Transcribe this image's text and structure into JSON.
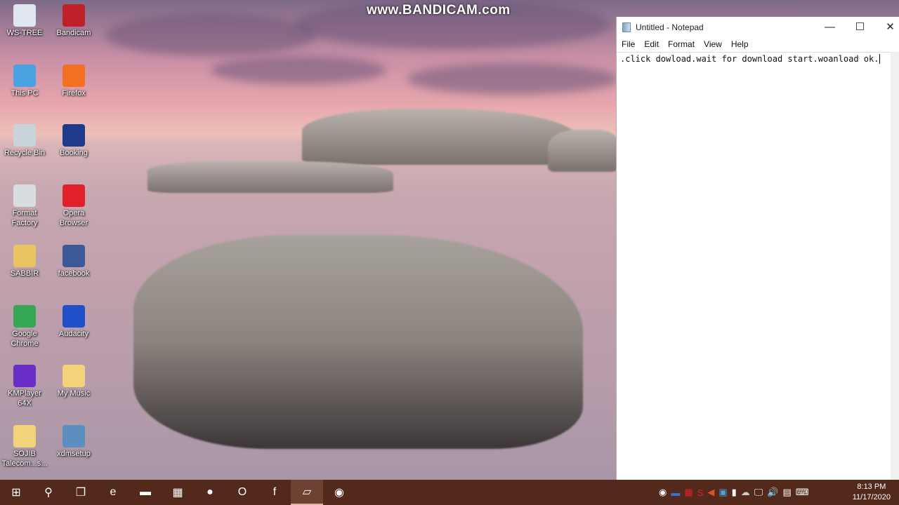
{
  "watermark": "www.BANDICAM.com",
  "desktop_icons": [
    {
      "label": "WS-TREE",
      "icon": "settings-shortcut-icon",
      "color": "#dfe6ee"
    },
    {
      "label": "Bandicam",
      "icon": "bandicam-icon",
      "color": "#c0202a"
    },
    {
      "label": "This PC",
      "icon": "computer-icon",
      "color": "#4aa3e0"
    },
    {
      "label": "Firefox",
      "icon": "firefox-icon",
      "color": "#f36f21"
    },
    {
      "label": "Recycle Bin",
      "icon": "recycle-bin-icon",
      "color": "#c9d3da"
    },
    {
      "label": "Booking",
      "icon": "booking-icon",
      "color": "#1e3a8a"
    },
    {
      "label": "Format Factory",
      "icon": "format-factory-icon",
      "color": "#d8dde2"
    },
    {
      "label": "Opera Browser",
      "icon": "opera-icon",
      "color": "#e0202a"
    },
    {
      "label": "SABBIR",
      "icon": "user-folder-icon",
      "color": "#e8c560"
    },
    {
      "label": "facebook",
      "icon": "facebook-icon",
      "color": "#3b5998"
    },
    {
      "label": "Google Chrome",
      "icon": "chrome-icon",
      "color": "#34a853"
    },
    {
      "label": "Audacity",
      "icon": "audacity-icon",
      "color": "#1f4fc9"
    },
    {
      "label": "KMPlayer 64X",
      "icon": "kmplayer-icon",
      "color": "#6a2fc9"
    },
    {
      "label": "My Music",
      "icon": "folder-icon",
      "color": "#f2d37a"
    },
    {
      "label": "SOJIB Talecom...s...",
      "icon": "folder-icon",
      "color": "#f2d37a"
    },
    {
      "label": "xdmsetup",
      "icon": "installer-icon",
      "color": "#5b8fbf"
    }
  ],
  "notepad": {
    "title": "Untitled - Notepad",
    "menu": [
      "File",
      "Edit",
      "Format",
      "View",
      "Help"
    ],
    "text": ".click dowload.wait for download start.woanload ok."
  },
  "taskbar": {
    "apps": [
      {
        "name": "start",
        "glyph": "⊞"
      },
      {
        "name": "search",
        "glyph": "⚲"
      },
      {
        "name": "task-view",
        "glyph": "❐"
      },
      {
        "name": "edge",
        "glyph": "e"
      },
      {
        "name": "file-explorer",
        "glyph": "▬"
      },
      {
        "name": "calculator",
        "glyph": "▦"
      },
      {
        "name": "firefox",
        "glyph": "●"
      },
      {
        "name": "opera",
        "glyph": "O"
      },
      {
        "name": "facebook",
        "glyph": "f"
      },
      {
        "name": "notepad",
        "glyph": "▱"
      },
      {
        "name": "bandicam",
        "glyph": "◉"
      }
    ],
    "time": "8:13 PM",
    "date": "11/17/2020"
  },
  "colors": {
    "taskbar": "#52291a",
    "accent": "#0078d7"
  }
}
